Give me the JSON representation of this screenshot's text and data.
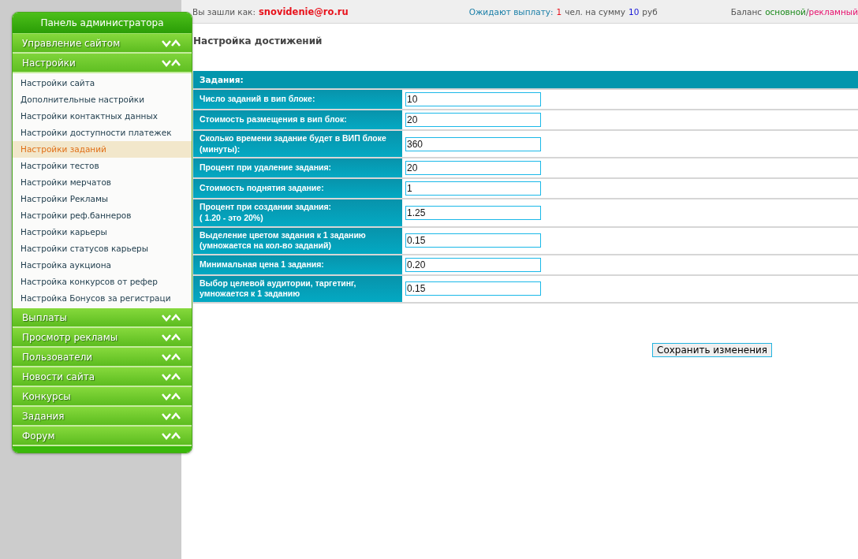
{
  "sidebar": {
    "title": "Панель администратора",
    "sections": [
      {
        "label": "Управление сайтом"
      },
      {
        "label": "Настройки",
        "items": [
          {
            "label": "Настройки сайта",
            "selected": false
          },
          {
            "label": "Дополнительные настройки",
            "selected": false
          },
          {
            "label": "Настройки контактных данных",
            "selected": false
          },
          {
            "label": "Настройки доступности платежек",
            "selected": false
          },
          {
            "label": "Настройки заданий",
            "selected": true
          },
          {
            "label": "Настройки тестов",
            "selected": false
          },
          {
            "label": "Настройки мерчатов",
            "selected": false
          },
          {
            "label": "Настройки Рекламы",
            "selected": false
          },
          {
            "label": "Настройки реф.баннеров",
            "selected": false
          },
          {
            "label": "Настройки карьеры",
            "selected": false
          },
          {
            "label": "Настройки статусов карьеры",
            "selected": false
          },
          {
            "label": "Настройка аукциона",
            "selected": false
          },
          {
            "label": "Настройка конкурсов от рефер",
            "selected": false
          },
          {
            "label": "Настройка Бонусов за регистраци",
            "selected": false
          }
        ]
      },
      {
        "label": "Выплаты"
      },
      {
        "label": "Просмотр рекламы"
      },
      {
        "label": "Пользователи"
      },
      {
        "label": "Новости сайта"
      },
      {
        "label": "Конкурсы"
      },
      {
        "label": "Задания"
      },
      {
        "label": "Форум"
      }
    ]
  },
  "top_bar": {
    "login_label": "Вы зашли как:",
    "login_user": "snovidenie@ro.ru",
    "payout_label": "Ожидают выплату:",
    "payout_count": "1",
    "payout_mid": "чел. на сумму",
    "payout_sum": "10",
    "payout_unit": "руб",
    "balance_label": "Баланс",
    "balance_main": "основной",
    "balance_sep": "/",
    "balance_ads": "рекламный"
  },
  "page_title": "Настройка достижений",
  "settings_table": {
    "header": "Задания:",
    "rows": [
      {
        "label": "Число заданий в вип блоке:",
        "value": "10"
      },
      {
        "label": "Стоимость размещения в вип блок:",
        "value": "20"
      },
      {
        "label": "Сколько времени задание будет в ВИП блоке (минуты):",
        "value": "360"
      },
      {
        "label": "Процент при удаление задания:",
        "value": "20"
      },
      {
        "label": "Стоимость поднятия задание:",
        "value": "1"
      },
      {
        "label": "Процент при создании задания:\n( 1.20 - это 20%)",
        "value": "1.25"
      },
      {
        "label": "Выделение цветом задания к 1 заданию (умножается на кол-во заданий)",
        "value": "0.15"
      },
      {
        "label": "Минимальная цена 1 задания:",
        "value": "0.20"
      },
      {
        "label": "Выбор целевой аудитории, таргетинг, умножается к 1 заданию",
        "value": "0.15"
      }
    ]
  },
  "save_button": "Сохранить изменения"
}
